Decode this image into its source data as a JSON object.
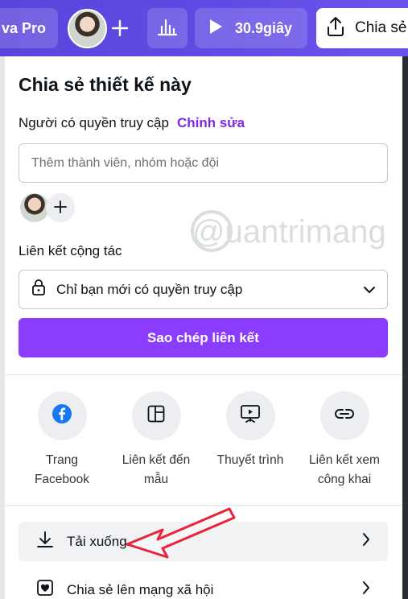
{
  "toolbar": {
    "pro_label": "va Pro",
    "play_label": "30.9giây",
    "share_label": "Chia sẻ",
    "icons": [
      "plus-icon",
      "bar-chart-icon",
      "play-icon",
      "upload-icon"
    ]
  },
  "panel": {
    "title": "Chia sẻ thiết kế này",
    "access_label": "Người có quyền truy cập",
    "access_edit": "Chỉnh sửa",
    "member_placeholder": "Thêm thành viên, nhóm hoặc đội",
    "collab_label": "Liên kết cộng tác",
    "link_access_value": "Chỉ bạn mới có quyền truy cập",
    "copy_link_button": "Sao chép liên kết",
    "share_options": [
      {
        "line1": "Trang",
        "line2": "Facebook",
        "icon": "facebook-icon"
      },
      {
        "line1": "Liên kết đến",
        "line2": "mẫu",
        "icon": "template-layout-icon"
      },
      {
        "line1": "Thuyết trình",
        "line2": "",
        "icon": "presentation-icon"
      },
      {
        "line1": "Liên kết xem",
        "line2": "công khai",
        "icon": "link-icon"
      }
    ],
    "download_label": "Tải xuống",
    "social_label": "Chia sẻ lên mạng xã hội"
  },
  "watermark": {
    "text": "@uantrimang"
  },
  "colors": {
    "toolbar": "#5f4be3",
    "accent": "#8b3dff",
    "edit_link": "#7d2ae8",
    "arrow": "#e8233a",
    "facebook": "#1877f2"
  }
}
